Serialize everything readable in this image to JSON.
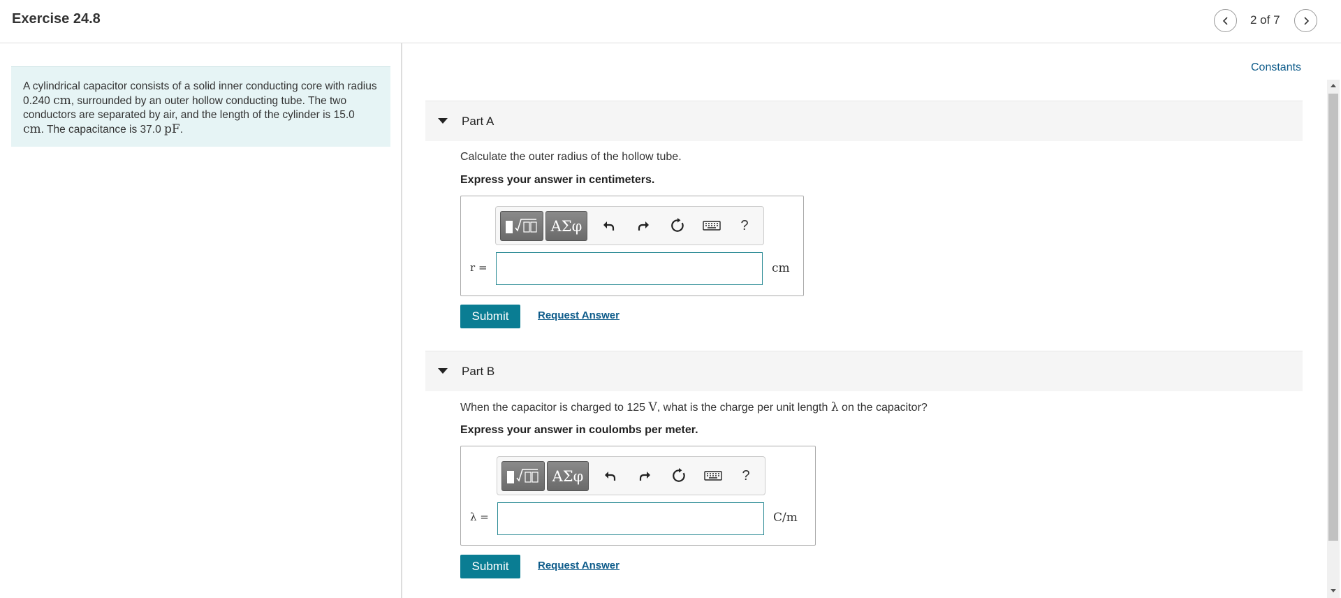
{
  "header": {
    "title": "Exercise 24.8",
    "page_count": "2 of 7"
  },
  "problem": {
    "s1": "A cylindrical capacitor consists of a solid inner conducting core with radius 0.240 ",
    "u1": "cm",
    "s2": ", surrounded by an outer hollow conducting tube. The two conductors are separated by air, and the length of the cylinder is 15.0 ",
    "u2": "cm",
    "s3": ". The capacitance is 37.0 ",
    "u3": "pF",
    "s4": "."
  },
  "constants_label": "Constants",
  "toolbar": {
    "greek_label": "ΑΣφ",
    "help_label": "?"
  },
  "part_a": {
    "label": "Part A",
    "question": "Calculate the outer radius of the hollow tube.",
    "instruction": "Express your answer in centimeters.",
    "var": "r =",
    "unit": "cm",
    "input_value": "",
    "submit_label": "Submit",
    "request_label": "Request Answer"
  },
  "part_b": {
    "label": "Part B",
    "q1": "When the capacitor is charged to 125 ",
    "qu": "V",
    "q2": ", what is the charge per unit length ",
    "ql": "λ",
    "q3": " on the capacitor?",
    "instruction": "Express your answer in coulombs per meter.",
    "var": "λ =",
    "unit": "C/m",
    "input_value": "",
    "submit_label": "Submit",
    "request_label": "Request Answer"
  },
  "colors": {
    "accent": "#0a7d93",
    "link": "#0d5b8a",
    "problem_bg": "#e6f4f5"
  }
}
